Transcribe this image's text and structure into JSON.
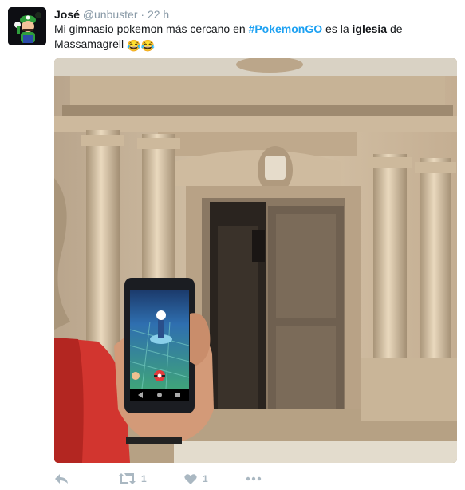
{
  "tweet": {
    "author_name": "José",
    "handle": "@unbuster",
    "separator": "·",
    "time": "22 h",
    "text_before": "Mi gimnasio pokemon más cercano en ",
    "hashtag": "#PokemonGO",
    "text_middle": " es la ",
    "bold_word": "iglesia",
    "text_after": " de Massamagrell ",
    "emoji": "😂😂"
  },
  "actions": {
    "reply_icon": "reply-icon",
    "retweet_icon": "retweet-icon",
    "retweet_count": "1",
    "like_icon": "heart-icon",
    "like_count": "1",
    "more_icon": "more-icon"
  },
  "colors": {
    "hashtag": "#1da1f2",
    "muted": "#8899a6",
    "action_icons": "#aab8c2"
  }
}
